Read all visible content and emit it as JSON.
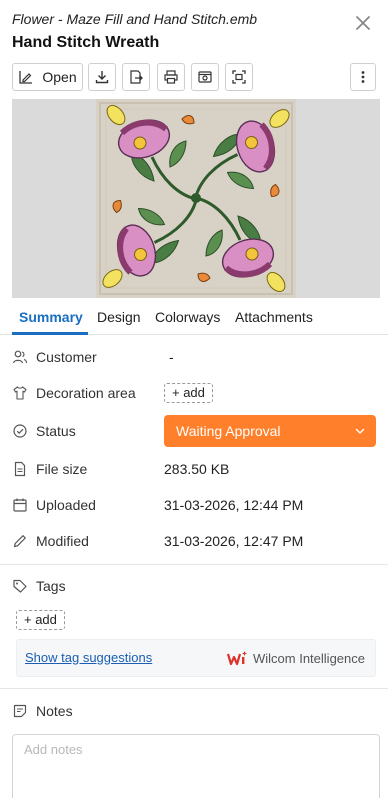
{
  "header": {
    "file_name": "Flower - Maze Fill and Hand Stitch.emb",
    "design_title": "Hand Stitch Wreath"
  },
  "toolbar": {
    "open_label": "Open",
    "icons": [
      "edit-design-icon",
      "download-icon",
      "export-icon",
      "print-icon",
      "preview-icon",
      "fit-view-icon",
      "more-vertical-icon"
    ]
  },
  "tabs": [
    "Summary",
    "Design",
    "Colorways",
    "Attachments"
  ],
  "properties": {
    "customer": {
      "label": "Customer",
      "value": "-"
    },
    "decoration_area": {
      "label": "Decoration area",
      "add_label": "+ add"
    },
    "status": {
      "label": "Status",
      "value": "Waiting Approval",
      "color": "#ff7f2a"
    },
    "file_size": {
      "label": "File size",
      "value": "283.50 KB"
    },
    "uploaded": {
      "label": "Uploaded",
      "value": "31-03-2026, 12:44 PM"
    },
    "modified": {
      "label": "Modified",
      "value": "31-03-2026, 12:47 PM"
    }
  },
  "tags": {
    "title": "Tags",
    "add_label": "+ add",
    "suggest_link": "Show tag suggestions",
    "brand": "Wilcom Intelligence"
  },
  "notes": {
    "title": "Notes",
    "placeholder": "Add notes"
  },
  "colors": {
    "accent": "#1a6fc2",
    "status": "#ff7f2a"
  }
}
